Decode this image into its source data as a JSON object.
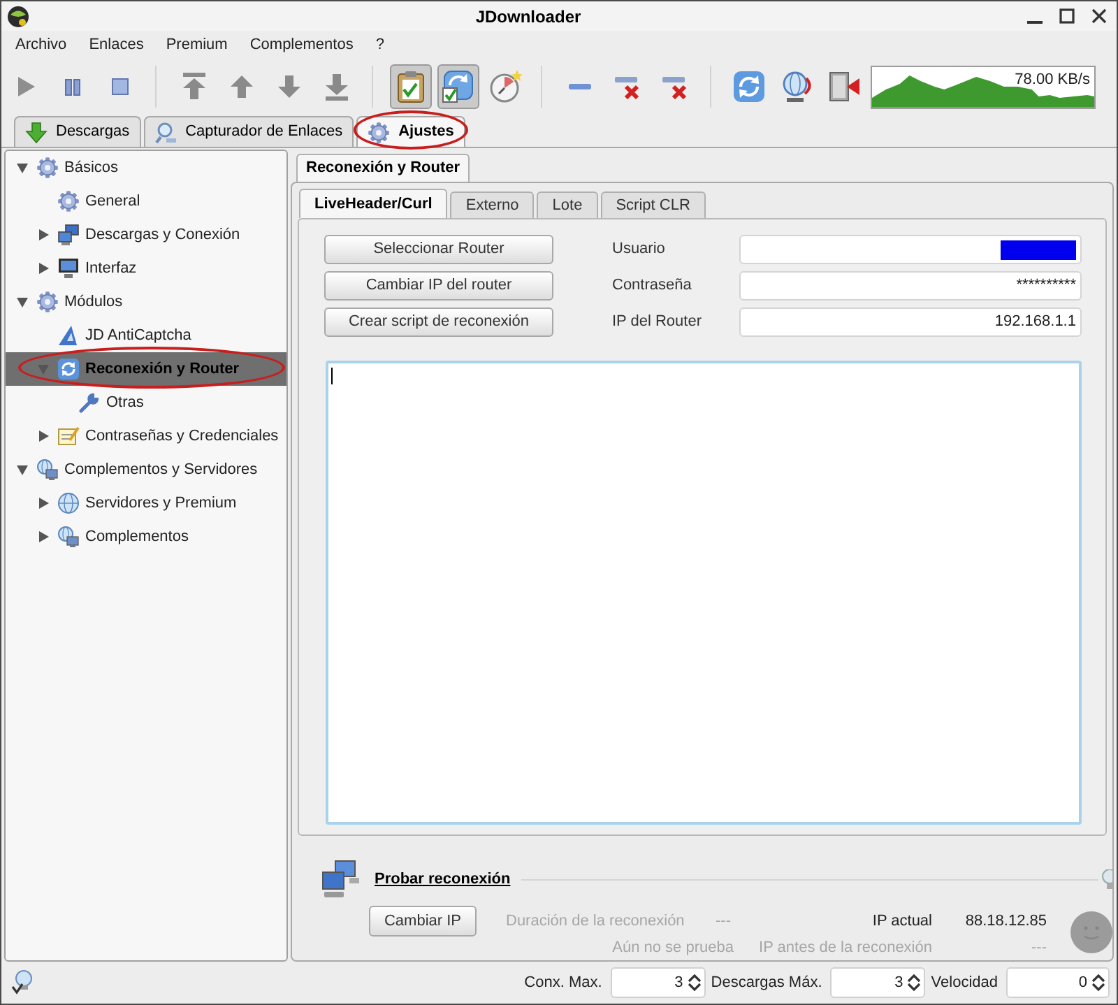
{
  "window": {
    "title": "JDownloader"
  },
  "menu": [
    "Archivo",
    "Enlaces",
    "Premium",
    "Complementos",
    "?"
  ],
  "toolbar": {
    "toggles": [
      {
        "on": true
      },
      {
        "on": true
      },
      {
        "on": false
      }
    ],
    "speed": "78.00 KB/s"
  },
  "main_tabs": [
    {
      "label": "Descargas",
      "selected": false,
      "circled": false
    },
    {
      "label": "Capturador de Enlaces",
      "selected": false,
      "circled": false
    },
    {
      "label": "Ajustes",
      "selected": true,
      "circled": true
    }
  ],
  "sidebar": {
    "items": [
      {
        "label": "Básicos",
        "expanded": true,
        "selected": false,
        "circled": false,
        "children": [
          {
            "label": "General",
            "selected": false,
            "circled": false
          },
          {
            "label": "Descargas y Conexión",
            "expanded": false,
            "selected": false,
            "circled": false
          },
          {
            "label": "Interfaz",
            "expanded": false,
            "selected": false,
            "circled": false
          }
        ]
      },
      {
        "label": "Módulos",
        "expanded": true,
        "selected": false,
        "circled": false,
        "children": [
          {
            "label": "JD AntiCaptcha",
            "selected": false,
            "circled": false
          },
          {
            "label": "Reconexión y Router",
            "expanded": true,
            "selected": true,
            "circled": true,
            "children": [
              {
                "label": "Otras",
                "selected": false,
                "circled": false
              }
            ]
          },
          {
            "label": "Contraseñas y Credenciales",
            "expanded": false,
            "selected": false,
            "circled": false
          }
        ]
      },
      {
        "label": "Complementos y Servidores",
        "expanded": true,
        "selected": false,
        "circled": false,
        "children": [
          {
            "label": "Servidores y Premium",
            "expanded": false,
            "selected": false,
            "circled": false
          },
          {
            "label": "Complementos",
            "expanded": false,
            "selected": false,
            "circled": false
          }
        ]
      }
    ]
  },
  "settings": {
    "tab": "Reconexión y Router",
    "subtabs": [
      {
        "label": "LiveHeader/Curl",
        "selected": true
      },
      {
        "label": "Externo",
        "selected": false
      },
      {
        "label": "Lote",
        "selected": false
      },
      {
        "label": "Script CLR",
        "selected": false
      }
    ],
    "actions": [
      "Seleccionar Router",
      "Cambiar IP del router",
      "Crear script de reconexión"
    ],
    "fields": [
      {
        "label": "Usuario",
        "redacted": true
      },
      {
        "label": "Contraseña",
        "value": "**********",
        "redacted": false
      },
      {
        "label": "IP del Router",
        "value": "192.168.1.1",
        "redacted": false
      }
    ]
  },
  "reconnect_test": {
    "title": "Probar reconexión",
    "button": "Cambiar IP",
    "duration_label": "Duración de la reconexión",
    "duration_value": "---",
    "status": "Aún no se prueba",
    "current_ip_label": "IP actual",
    "current_ip": "88.18.12.85",
    "previous_ip_label": "IP antes de la reconexión",
    "previous_ip": "---"
  },
  "status_bar": {
    "spinners": [
      {
        "label": "Conx. Max.",
        "value": "3"
      },
      {
        "label": "Descargas Máx.",
        "value": "3"
      },
      {
        "label": "Velocidad",
        "value": "0"
      }
    ]
  }
}
